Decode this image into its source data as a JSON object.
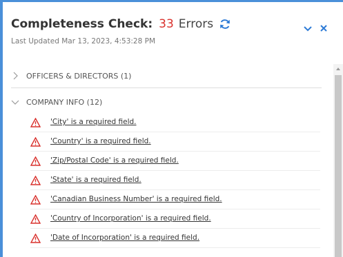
{
  "header": {
    "title": "Completeness Check:",
    "error_count": "33",
    "errors_label": "Errors",
    "last_updated": "Last Updated Mar 13, 2023, 4:53:28 PM",
    "refresh_icon": "refresh-icon",
    "collapse_icon": "chevron-down-icon",
    "close_icon": "close-icon"
  },
  "colors": {
    "accent": "#2e7bd6",
    "error": "#d9302c",
    "frame": "#4a90d9"
  },
  "sections": [
    {
      "label": "OFFICERS & DIRECTORS (1)",
      "expanded": false
    },
    {
      "label": "COMPANY INFO (12)",
      "expanded": true
    }
  ],
  "company_info_items": [
    {
      "message": "'City' is a required field."
    },
    {
      "message": "'Country' is a required field."
    },
    {
      "message": "'Zip/Postal Code' is a required field."
    },
    {
      "message": "'State' is a required field."
    },
    {
      "message": "'Canadian Business Number' is a required field."
    },
    {
      "message": "'Country of Incorporation' is a required field."
    },
    {
      "message": "'Date of Incorporation' is a required field."
    }
  ]
}
